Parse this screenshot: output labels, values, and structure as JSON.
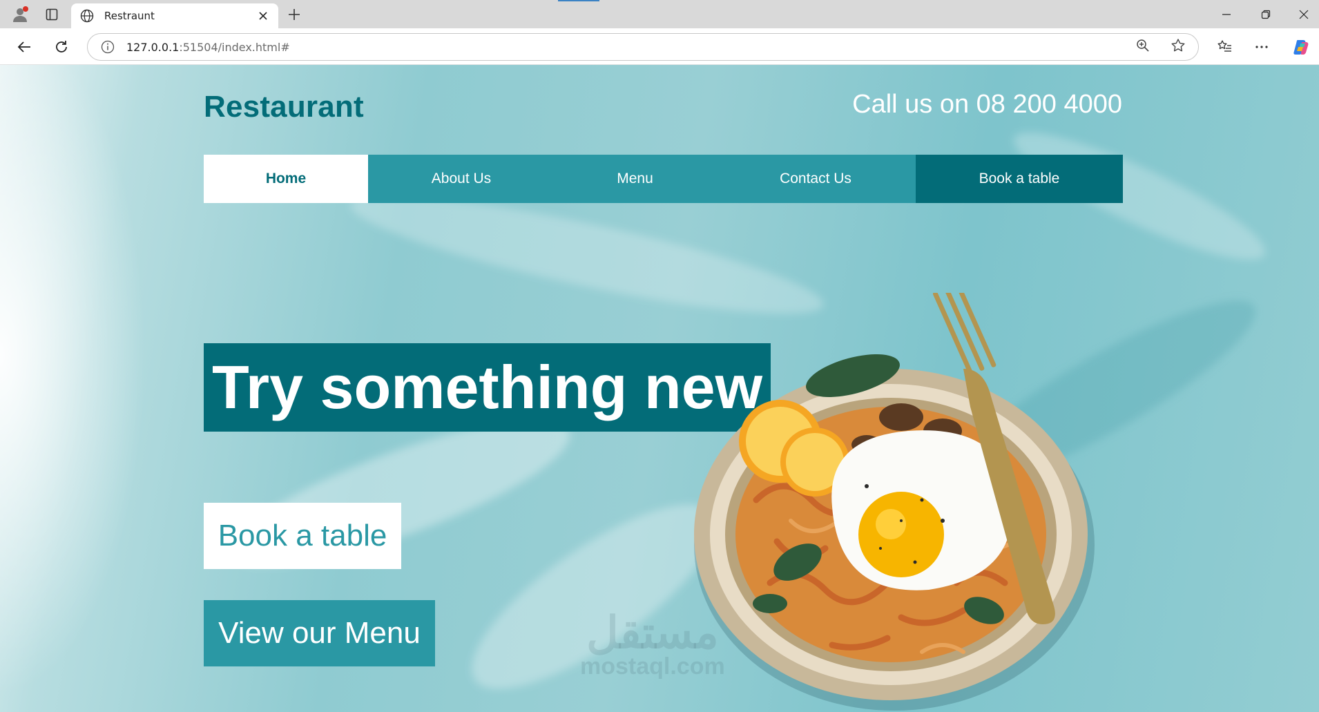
{
  "browser": {
    "tab_title": "Restraunt",
    "url_host": "127.0.0.1",
    "url_rest": ":51504/index.html#",
    "icons": [
      "profile-icon",
      "sidebar-toggle-icon",
      "globe-icon",
      "close-icon",
      "plus-icon",
      "minimize-icon",
      "restore-icon",
      "window-close-icon",
      "back-arrow-icon",
      "reload-icon",
      "info-icon",
      "zoom-icon",
      "star-icon",
      "favorites-icon",
      "more-icon",
      "copilot-icon"
    ]
  },
  "site": {
    "logo": "Restaurant",
    "phone": "Call us on 08 200 4000",
    "nav": {
      "home": "Home",
      "about": "About Us",
      "menu": "Menu",
      "contact": "Contact Us",
      "book": "Book a table"
    },
    "hero_title": "Try something new",
    "book_button": "Book a table",
    "menu_button": "View our Menu"
  },
  "watermark": {
    "arabic": "مستقل",
    "latin": "mostaql.com"
  },
  "colors": {
    "brand_dark": "#036c78",
    "brand_mid": "#2a98a4",
    "background": "#8fcbd1"
  }
}
